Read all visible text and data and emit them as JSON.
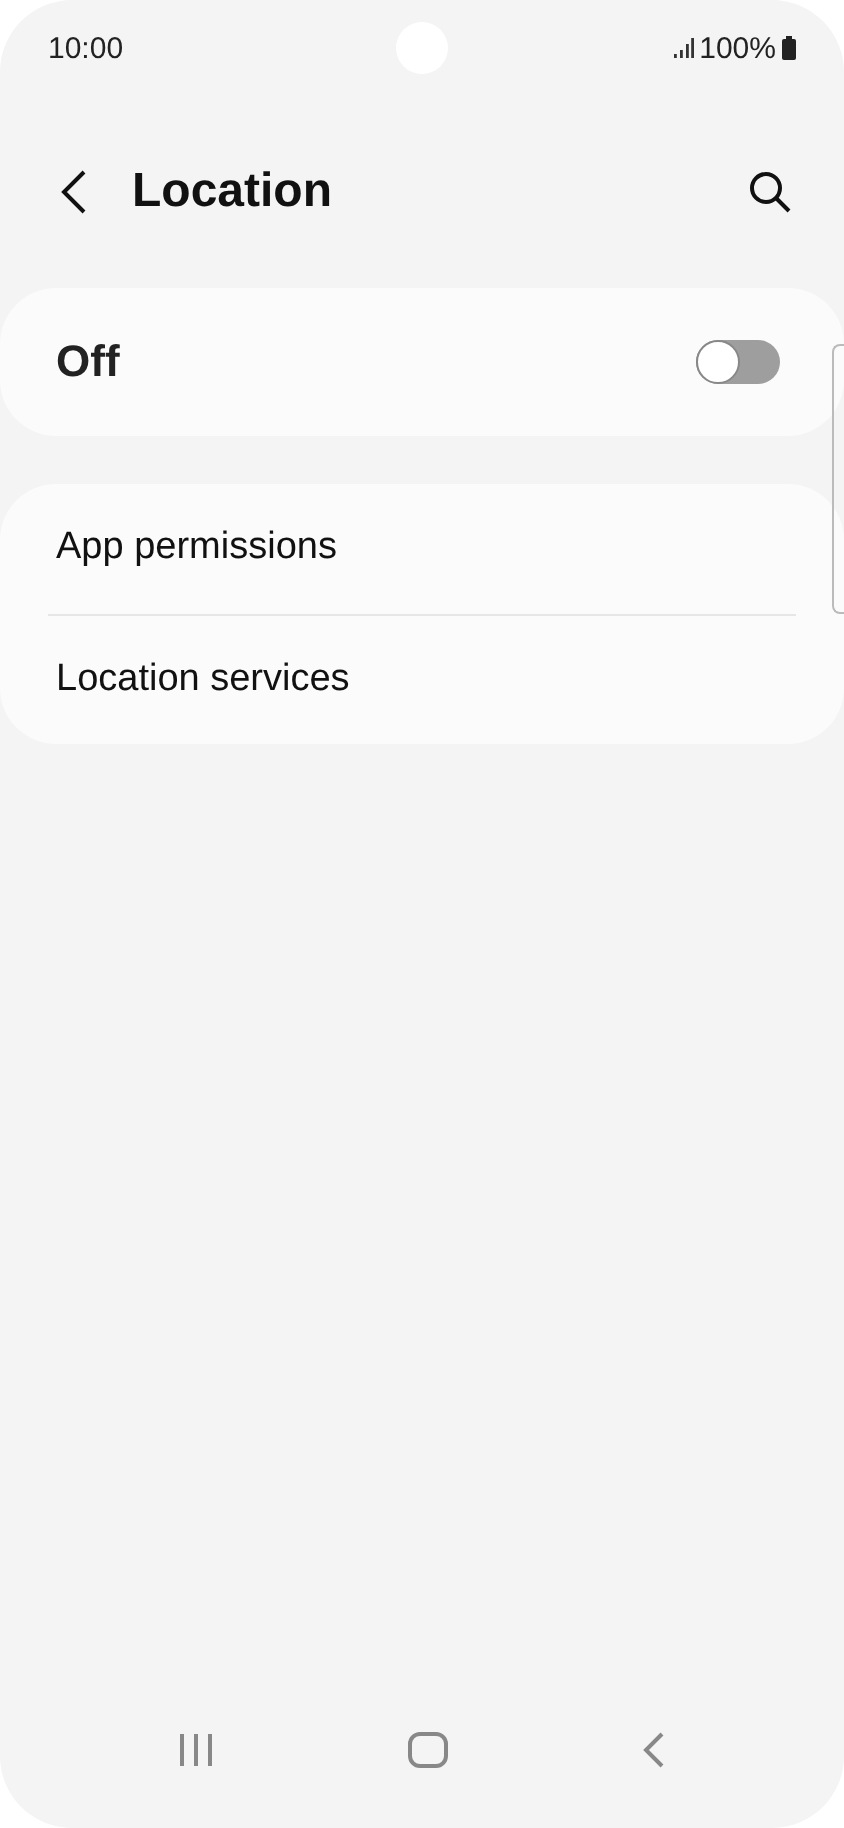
{
  "status_bar": {
    "time": "10:00",
    "battery": "100%"
  },
  "header": {
    "title": "Location"
  },
  "master_switch": {
    "label": "Off",
    "on": false
  },
  "items": [
    {
      "label": "App permissions"
    },
    {
      "label": "Location services"
    }
  ]
}
